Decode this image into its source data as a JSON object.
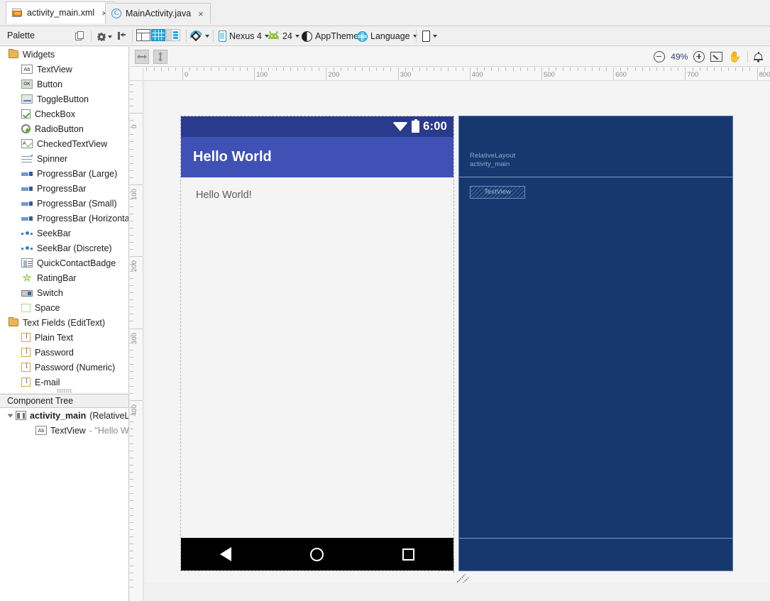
{
  "tabs": [
    {
      "label": "activity_main.xml",
      "icon": "xml-file-icon",
      "close": "×",
      "active": true,
      "badge": "<>"
    },
    {
      "label": "MainActivity.java",
      "icon": "java-class-icon",
      "close": "×",
      "active": false,
      "badge": "C"
    }
  ],
  "palette_header": {
    "title": "Palette",
    "copy_icon": "copy-icon",
    "gear_icon": "gear-icon",
    "collapse_icon": "collapse-panel-icon"
  },
  "design_toolbar": {
    "mode_design": "design-mode-button",
    "mode_blueprint": "blueprint-mode-button",
    "mode_both": "design-and-blueprint-button",
    "rotate_icon": "rotate-orientation-icon",
    "device": "Nexus 4",
    "api_level": "24",
    "theme": "AppTheme",
    "language": "Language",
    "locale_device_icon": "device-variant-icon"
  },
  "canvas_toolbar": {
    "constrain_horizontal": "constrain-horizontal-button",
    "constrain_vertical": "constrain-vertical-button",
    "zoom_out": "zoom-out-icon",
    "zoom_level": "49%",
    "zoom_in": "zoom-in-icon",
    "zoom_fit": "zoom-to-fit-icon",
    "pan": "✋",
    "notifications": "bell-icon"
  },
  "palette": {
    "groups": [
      {
        "label": "Widgets",
        "icon": "folder-icon",
        "items": [
          {
            "label": "TextView",
            "icon": "textview-icon",
            "glyph": "Ab"
          },
          {
            "label": "Button",
            "icon": "button-icon",
            "glyph": "OK"
          },
          {
            "label": "ToggleButton",
            "icon": "togglebutton-icon",
            "glyph": ""
          },
          {
            "label": "CheckBox",
            "icon": "checkbox-icon",
            "glyph": ""
          },
          {
            "label": "RadioButton",
            "icon": "radiobutton-icon",
            "glyph": ""
          },
          {
            "label": "CheckedTextView",
            "icon": "checkedtextview-icon",
            "glyph": "A"
          },
          {
            "label": "Spinner",
            "icon": "spinner-icon",
            "glyph": ""
          },
          {
            "label": "ProgressBar (Large)",
            "icon": "progressbar-icon",
            "glyph": ""
          },
          {
            "label": "ProgressBar",
            "icon": "progressbar-icon",
            "glyph": ""
          },
          {
            "label": "ProgressBar (Small)",
            "icon": "progressbar-icon",
            "glyph": ""
          },
          {
            "label": "ProgressBar (Horizontal)",
            "icon": "progressbar-icon",
            "glyph": ""
          },
          {
            "label": "SeekBar",
            "icon": "seekbar-icon",
            "glyph": ""
          },
          {
            "label": "SeekBar (Discrete)",
            "icon": "seekbar-icon",
            "glyph": ""
          },
          {
            "label": "QuickContactBadge",
            "icon": "quickcontactbadge-icon",
            "glyph": ""
          },
          {
            "label": "RatingBar",
            "icon": "ratingbar-icon",
            "glyph": ""
          },
          {
            "label": "Switch",
            "icon": "switch-icon",
            "glyph": ""
          },
          {
            "label": "Space",
            "icon": "space-icon",
            "glyph": ""
          }
        ]
      },
      {
        "label": "Text Fields (EditText)",
        "icon": "folder-icon",
        "items": [
          {
            "label": "Plain Text",
            "icon": "edittext-icon",
            "glyph": "I"
          },
          {
            "label": "Password",
            "icon": "edittext-icon",
            "glyph": "I"
          },
          {
            "label": "Password (Numeric)",
            "icon": "edittext-icon",
            "glyph": "I"
          },
          {
            "label": "E-mail",
            "icon": "edittext-icon",
            "glyph": "I"
          }
        ]
      }
    ]
  },
  "component_tree": {
    "title": "Component Tree",
    "root": {
      "name": "activity_main",
      "type": "(RelativeLa",
      "icon": "relativelayout-icon",
      "expander": "expanded-triangle-icon"
    },
    "children": [
      {
        "name": "TextView",
        "detail": "- \"Hello Wo",
        "icon": "textview-icon",
        "glyph": "Ab"
      }
    ]
  },
  "rulers": {
    "horizontal": [
      "0",
      "100",
      "200",
      "300",
      "400",
      "500",
      "600",
      "700",
      "800"
    ],
    "vertical": [
      "0",
      "100",
      "200",
      "300",
      "400"
    ]
  },
  "device_preview": {
    "status_bar": {
      "clock": "6:00",
      "wifi_icon": "wifi-icon",
      "battery_icon": "battery-icon"
    },
    "app_bar": {
      "title": "Hello World"
    },
    "content": {
      "text": "Hello World!"
    },
    "nav_bar": {
      "back": "back-nav-icon",
      "home": "home-nav-icon",
      "recents": "recents-nav-icon"
    }
  },
  "blueprint": {
    "root_type": "RelativeLayout",
    "root_id": "activity_main",
    "textview_label": "TextView"
  },
  "colors": {
    "app_bar": "#3f51b5",
    "status_bar": "#2a3a8c",
    "blueprint_bg": "#17386e",
    "accent": "#26a8e0"
  }
}
